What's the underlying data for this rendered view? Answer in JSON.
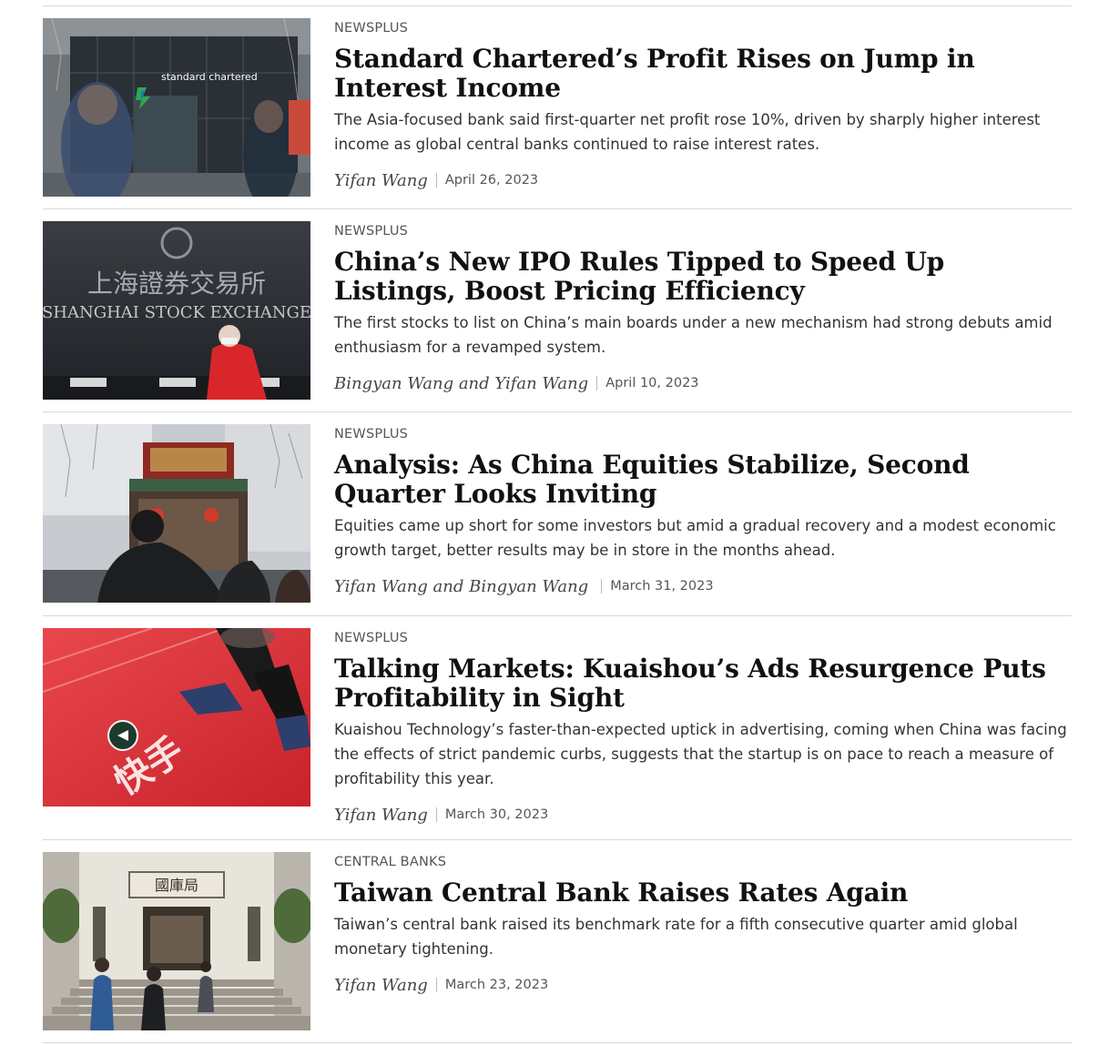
{
  "articles": [
    {
      "category": "NEWSPLUS",
      "headline": "Standard Chartered’s Profit Rises on Jump in Interest Income",
      "summary": "The Asia-focused bank said first-quarter net profit rose 10%, driven by sharply higher interest income as global central banks continued to raise interest rates.",
      "author": "Yifan Wang",
      "date": "April 26, 2023",
      "image_sign": "standard chartered"
    },
    {
      "category": "NEWSPLUS",
      "headline": "China’s New IPO Rules Tipped to Speed Up Listings, Boost Pricing Efficiency",
      "summary": "The first stocks to list on China’s main boards under a new mechanism had strong debuts amid enthusiasm for a revamped system.",
      "author": "Bingyan Wang and Yifan Wang",
      "date": "April 10, 2023",
      "image_sign_cn": "上海證券交易所",
      "image_sign_en": "SHANGHAI STOCK EXCHANGE"
    },
    {
      "category": "NEWSPLUS",
      "headline": "Analysis: As China Equities Stabilize, Second Quarter Looks Inviting",
      "summary": "Equities came up short for some investors but amid a gradual recovery and a modest economic growth target, better results may be in store in the months ahead.",
      "author": "Yifan Wang and Bingyan Wang",
      "date": "March 31, 2023"
    },
    {
      "category": "NEWSPLUS",
      "headline": "Talking Markets: Kuaishou’s Ads Resurgence Puts Profitability in Sight",
      "summary": "Kuaishou Technology’s faster-than-expected uptick in advertising, coming when China was facing the effects of strict pandemic curbs, suggests that the startup is on pace to reach a measure of profitability this year.",
      "author": "Yifan Wang",
      "date": "March 30, 2023",
      "image_sign": "快手"
    },
    {
      "category": "CENTRAL BANKS",
      "headline": "Taiwan Central Bank Raises Rates Again",
      "summary": "Taiwan’s central bank raised its benchmark rate for a fifth consecutive quarter amid global monetary tightening.",
      "author": "Yifan Wang",
      "date": "March 23, 2023",
      "image_sign": "國庫局"
    }
  ],
  "colors": {
    "headline": "#111111",
    "divider": "#d9d9d9",
    "kuaishou_red": "#d8323a"
  }
}
